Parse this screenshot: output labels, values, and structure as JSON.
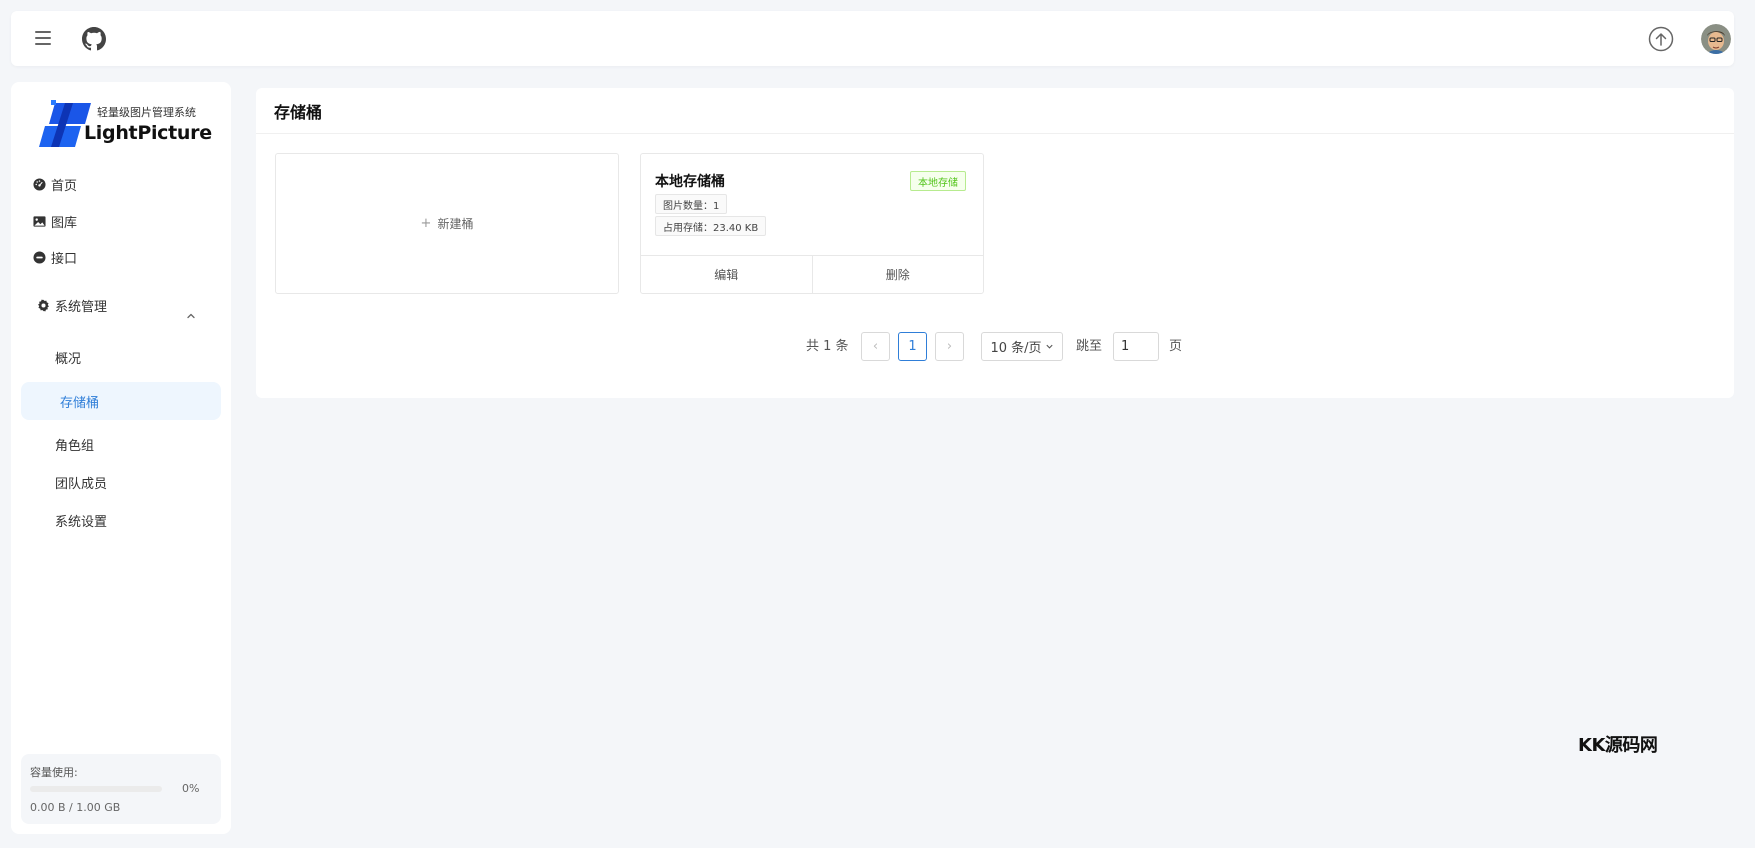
{
  "header": {
    "menu_icon": "hamburger-icon",
    "github_icon": "github-icon",
    "upload_icon": "upload-icon",
    "avatar_icon": "avatar"
  },
  "sidebar": {
    "logo_subtitle": "轻量级图片管理系统",
    "logo_name": "LightPicture",
    "items": [
      {
        "label": "首页",
        "icon": "dashboard-icon"
      },
      {
        "label": "图库",
        "icon": "image-icon"
      },
      {
        "label": "接口",
        "icon": "api-icon"
      }
    ],
    "group": {
      "label": "系统管理",
      "icon": "gear-icon",
      "children": [
        "概况",
        "存储桶",
        "角色组",
        "团队成员",
        "系统设置"
      ],
      "active": "存储桶"
    },
    "quota": {
      "label": "容量使用:",
      "percent": 0,
      "percent_text": "0%",
      "usage": "0.00 B / 1.00 GB"
    }
  },
  "main": {
    "title": "存储桶",
    "new_bucket_label": "新建桶",
    "bucket": {
      "name": "本地存储桶",
      "tag": "本地存储",
      "image_count": "图片数量：1",
      "storage_used": "占用存储：23.40 KB",
      "edit_label": "编辑",
      "delete_label": "删除"
    },
    "pagination": {
      "total": "共 1 条",
      "prev": "‹",
      "current": "1",
      "next": "›",
      "page_size": "10 条/页",
      "jump_label": "跳至",
      "jump_value": "1",
      "page_suffix": "页"
    }
  },
  "watermark": "KK源码网",
  "colors": {
    "accent": "#2f7ed8",
    "active_bg": "#eef6fe",
    "tag_green": "#52c41a",
    "background": "#f4f6f9"
  }
}
